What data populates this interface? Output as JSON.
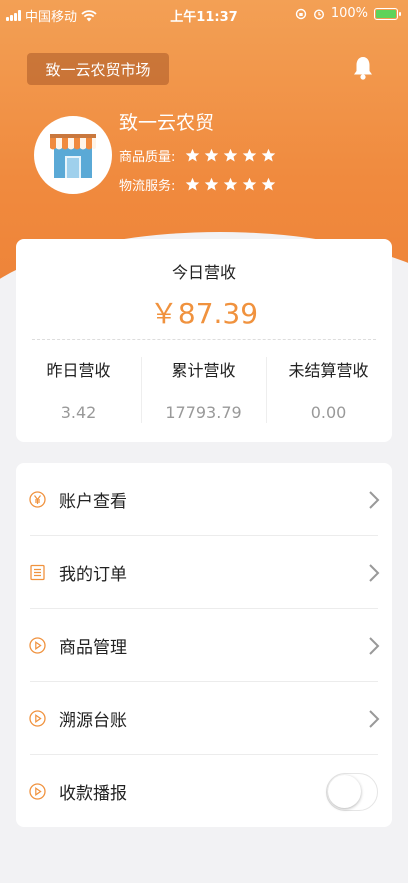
{
  "status_bar": {
    "carrier": "中国移动",
    "time": "上午11:37",
    "battery": "100%",
    "battery_level": 1.0
  },
  "header": {
    "market_button": "致一云农贸市场",
    "store_name": "致一云农贸",
    "quality_label": "商品质量:",
    "quality_stars": 5,
    "logistics_label": "物流服务:",
    "logistics_stars": 5
  },
  "revenue": {
    "today_label": "今日营收",
    "today_value": "￥87.39",
    "stats": [
      {
        "label": "昨日营收",
        "value": "3.42"
      },
      {
        "label": "累计营收",
        "value": "17793.79"
      },
      {
        "label": "未结算营收",
        "value": "0.00"
      }
    ]
  },
  "menu": {
    "items": [
      {
        "label": "账户查看",
        "icon": "yen-circle-icon"
      },
      {
        "label": "我的订单",
        "icon": "clipboard-icon"
      },
      {
        "label": "商品管理",
        "icon": "play-circle-icon"
      },
      {
        "label": "溯源台账",
        "icon": "play-circle-icon"
      },
      {
        "label": "收款播报",
        "icon": "play-circle-icon",
        "toggle_on": false
      }
    ]
  },
  "colors": {
    "accent": "#f0923e",
    "header_top": "#f3a055",
    "header_bottom": "#ee8338"
  }
}
